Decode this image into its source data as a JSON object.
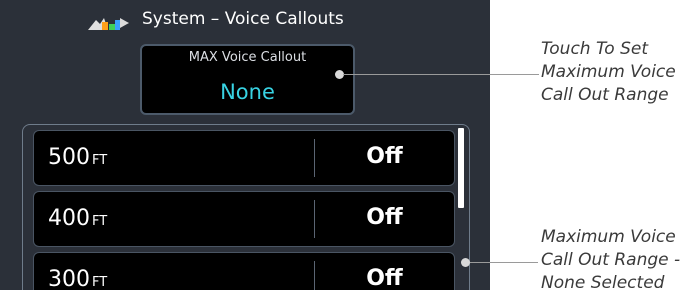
{
  "header": {
    "title": "System – Voice Callouts"
  },
  "max_voice_callout": {
    "label": "MAX Voice Callout",
    "value": "None"
  },
  "rows": [
    {
      "altitude": "500",
      "unit": "FT",
      "state": "Off"
    },
    {
      "altitude": "400",
      "unit": "FT",
      "state": "Off"
    },
    {
      "altitude": "300",
      "unit": "FT",
      "state": "Off"
    }
  ],
  "annotations": {
    "callout_top": [
      "Touch To Set",
      "Maximum Voice",
      "Call Out Range"
    ],
    "callout_bottom": [
      "Maximum Voice",
      "Call Out Range -",
      "None Selected"
    ]
  },
  "colors": {
    "screen_bg": "#2b3039",
    "value_cyan": "#38d3e3",
    "button_bg": "#000000"
  },
  "icons": {
    "title_icon": "system-tools-icon"
  }
}
